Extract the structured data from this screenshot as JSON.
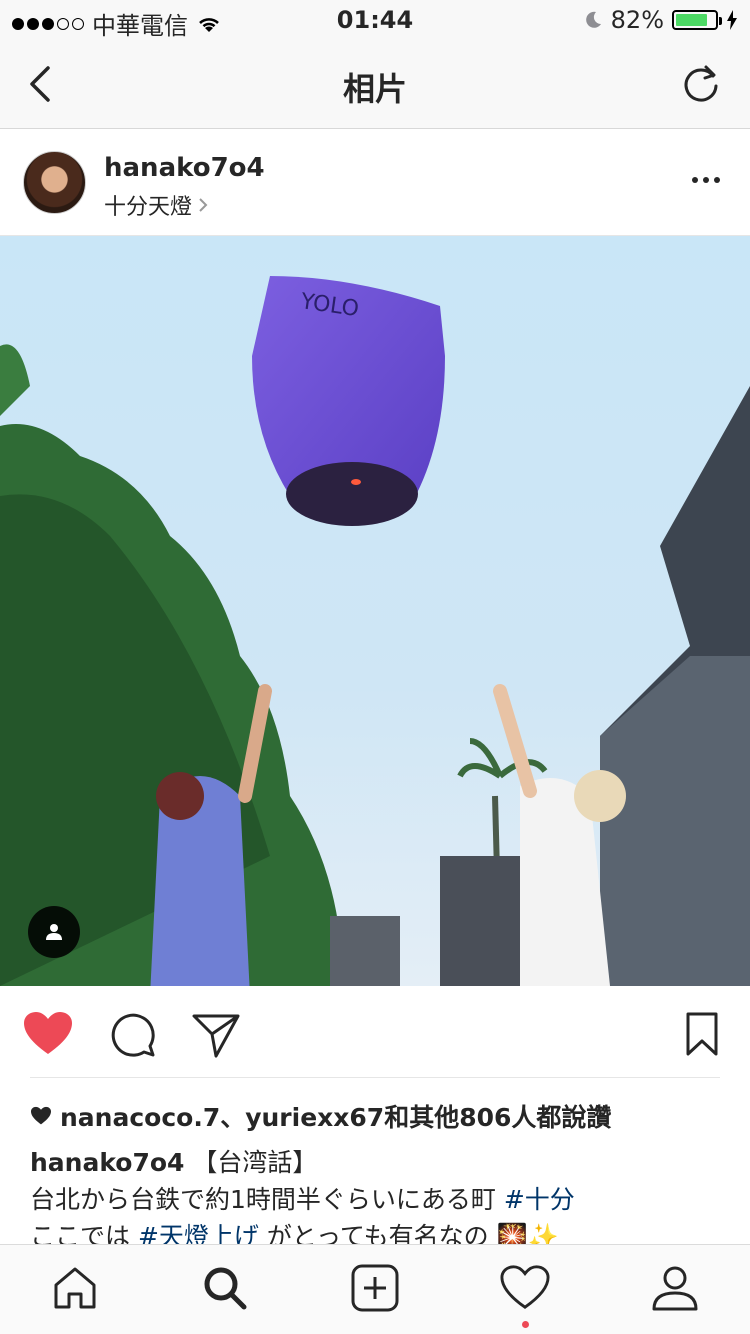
{
  "status_bar": {
    "carrier": "中華電信",
    "time": "01:44",
    "battery_percent": "82%",
    "battery_level": 0.82
  },
  "nav": {
    "title": "相片",
    "back_icon": "chevron-left-icon",
    "refresh_icon": "refresh-icon"
  },
  "post": {
    "username": "hanako7o4",
    "location": "十分天燈",
    "more_icon": "more-horizontal-icon",
    "photo_description_icon": "user-tag-icon"
  },
  "actions": {
    "like_icon": "heart-filled-icon",
    "comment_icon": "comment-icon",
    "share_icon": "direct-share-icon",
    "save_icon": "bookmark-icon",
    "like_color": "#ed4956"
  },
  "likes": {
    "text": "nanacoco.7、yuriexx67和其他806人都說讚"
  },
  "caption": {
    "username": "hanako7o4",
    "line1_text": "【台湾話】",
    "line2_text": "台北から台鉄で約1時間半ぐらいにある町 ",
    "line2_tag": "#十分",
    "line3_prefix": "ここでは ",
    "line3_tag": "#天燈上げ",
    "line3_suffix": " がとっても有名なの 🎇✨"
  },
  "tab_bar": {
    "items": [
      "home-icon",
      "search-icon",
      "new-post-icon",
      "activity-icon",
      "profile-icon"
    ],
    "active": "search-icon"
  }
}
